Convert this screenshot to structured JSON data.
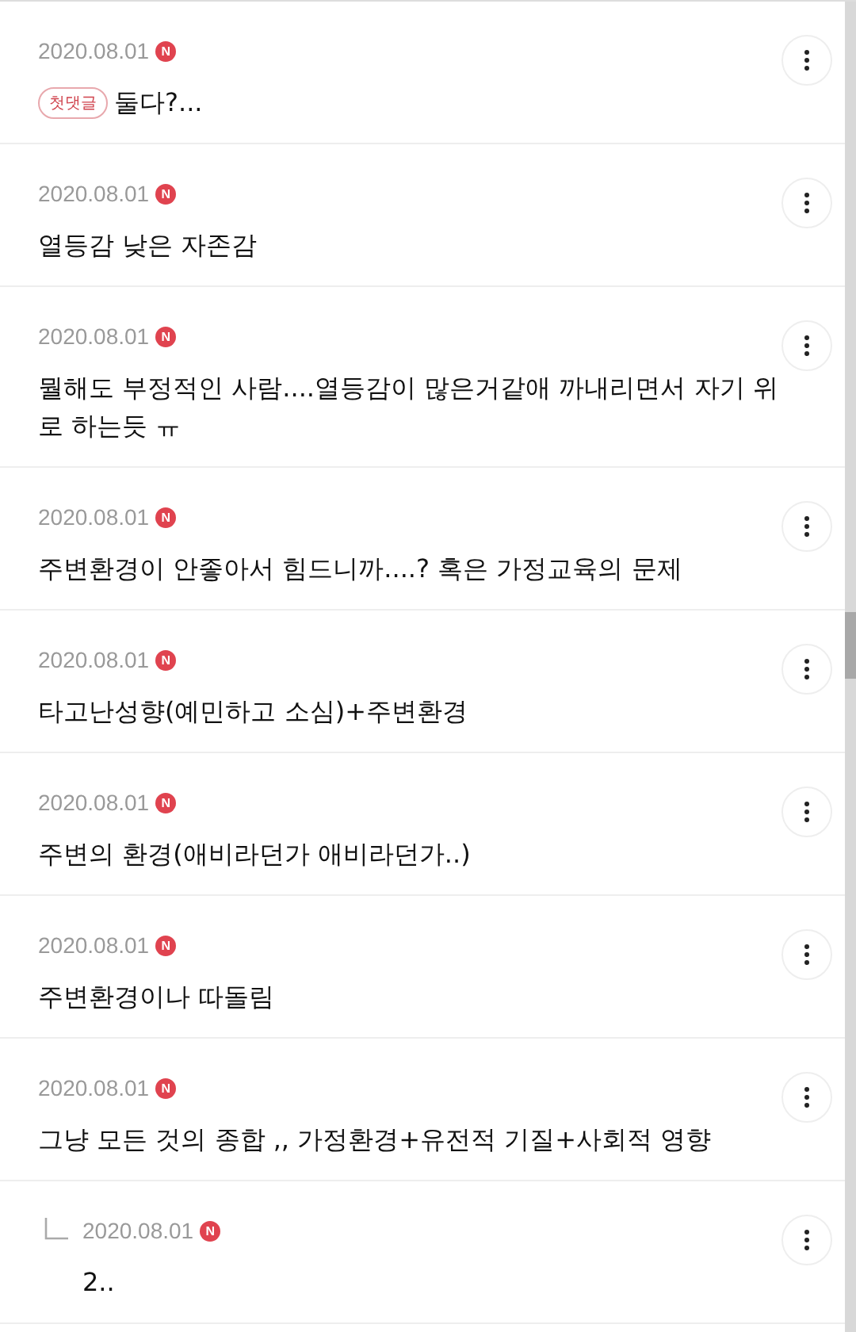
{
  "comments": [
    {
      "kind": "comment",
      "date": "2020.08.01",
      "badge": "N",
      "tag": "첫댓글",
      "text": "둘다?..."
    },
    {
      "kind": "comment",
      "date": "2020.08.01",
      "badge": "N",
      "text": "열등감 낮은 자존감"
    },
    {
      "kind": "comment",
      "date": "2020.08.01",
      "badge": "N",
      "text": "뭘해도 부정적인 사람....열등감이 많은거같애 까내리면서 자기 위로 하는듯 ㅠ"
    },
    {
      "kind": "comment",
      "date": "2020.08.01",
      "badge": "N",
      "text": "주변환경이 안좋아서 힘드니까....? 혹은 가정교육의 문제"
    },
    {
      "kind": "comment",
      "date": "2020.08.01",
      "badge": "N",
      "text": "타고난성향(예민하고 소심)+주변환경"
    },
    {
      "kind": "comment",
      "date": "2020.08.01",
      "badge": "N",
      "text": "주변의 환경(애비라던가 애비라던가..)"
    },
    {
      "kind": "comment",
      "date": "2020.08.01",
      "badge": "N",
      "text": "주변환경이나 따돌림"
    },
    {
      "kind": "comment",
      "date": "2020.08.01",
      "badge": "N",
      "text": "그냥 모든 것의 종합 ,, 가정환경+유전적 기질+사회적 영향"
    },
    {
      "kind": "reply",
      "date": "2020.08.01",
      "badge": "N",
      "text": "2.."
    }
  ]
}
